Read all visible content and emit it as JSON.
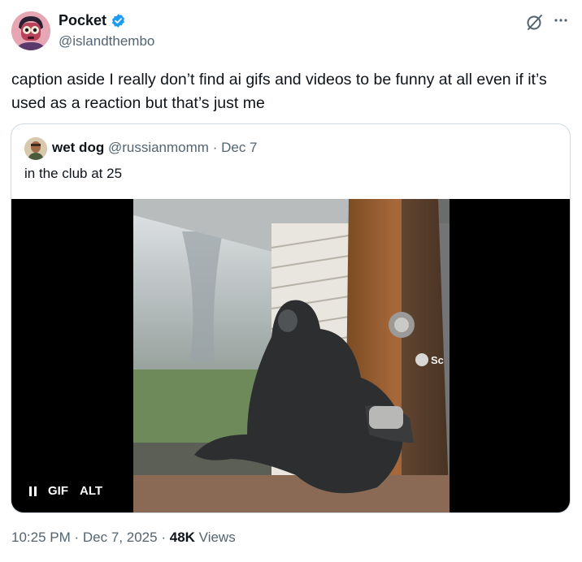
{
  "author": {
    "name": "Pocket",
    "handle": "@islandthembo",
    "verified": true
  },
  "tweet": {
    "text": "caption aside I really don’t find ai gifs and videos to be funny at all even if it’s used as a reaction but that’s just me"
  },
  "quoted_tweet": {
    "name": "wet dog",
    "handle": "@russianmomm",
    "separator": "·",
    "date": "Dec 7",
    "text": "in the club at 25",
    "media": {
      "type": "GIF",
      "gif_label": "GIF",
      "alt_label": "ALT",
      "overlay_text": "Sc"
    }
  },
  "footer": {
    "time": "10:25 PM",
    "sep1": "·",
    "date": "Dec 7, 2025",
    "sep2": "·",
    "views_count": "48K",
    "views_label": "Views"
  },
  "colors": {
    "verified_blue": "#1d9bf0",
    "muted_text": "#536471",
    "border": "#cfd9de"
  }
}
